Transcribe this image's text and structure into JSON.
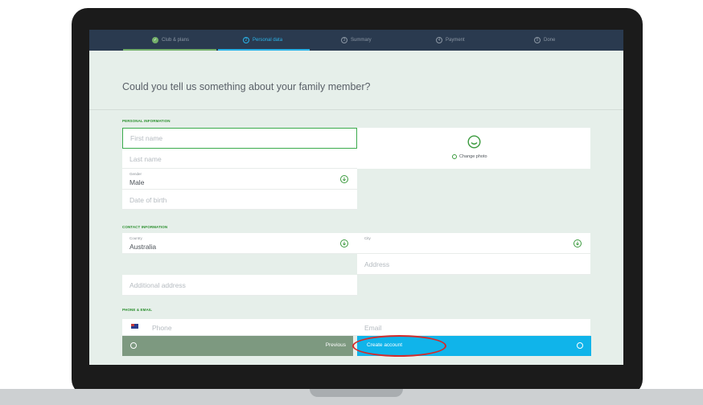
{
  "steps": [
    {
      "label": "Club & plans",
      "state": "done"
    },
    {
      "label": "Personal data",
      "state": "active"
    },
    {
      "label": "Summary",
      "state": "todo"
    },
    {
      "label": "Payment",
      "state": "todo"
    },
    {
      "label": "Done",
      "state": "todo"
    }
  ],
  "headline": "Could you tell us something about your family member?",
  "personal": {
    "section_title": "PERSONAL INFORMATION",
    "first_name_placeholder": "First name",
    "last_name_placeholder": "Last name",
    "gender_label": "Gender",
    "gender_value": "Male",
    "dob_placeholder": "Date of birth",
    "change_photo": "Change photo"
  },
  "contact": {
    "section_title": "CONTACT INFORMATION",
    "country_label": "Country",
    "country_value": "Australia",
    "city_label": "City",
    "address_placeholder": "Address",
    "additional_address_placeholder": "Additional address"
  },
  "phone_email": {
    "section_title": "PHONE & EMAIL",
    "phone_placeholder": "Phone",
    "email_placeholder": "Email"
  },
  "actions": {
    "previous": "Previous",
    "create_account": "Create account"
  },
  "colors": {
    "accent_green": "#3a9a3d",
    "accent_blue": "#10b4ea",
    "highlight_red": "#d42a2a",
    "stepbar": "#2a3a4f"
  },
  "icons": {
    "photo": "smiley-icon",
    "dropdown": "arrow-down-circle-icon",
    "previous": "arrow-left-circle-icon",
    "create": "arrow-right-circle-icon"
  }
}
